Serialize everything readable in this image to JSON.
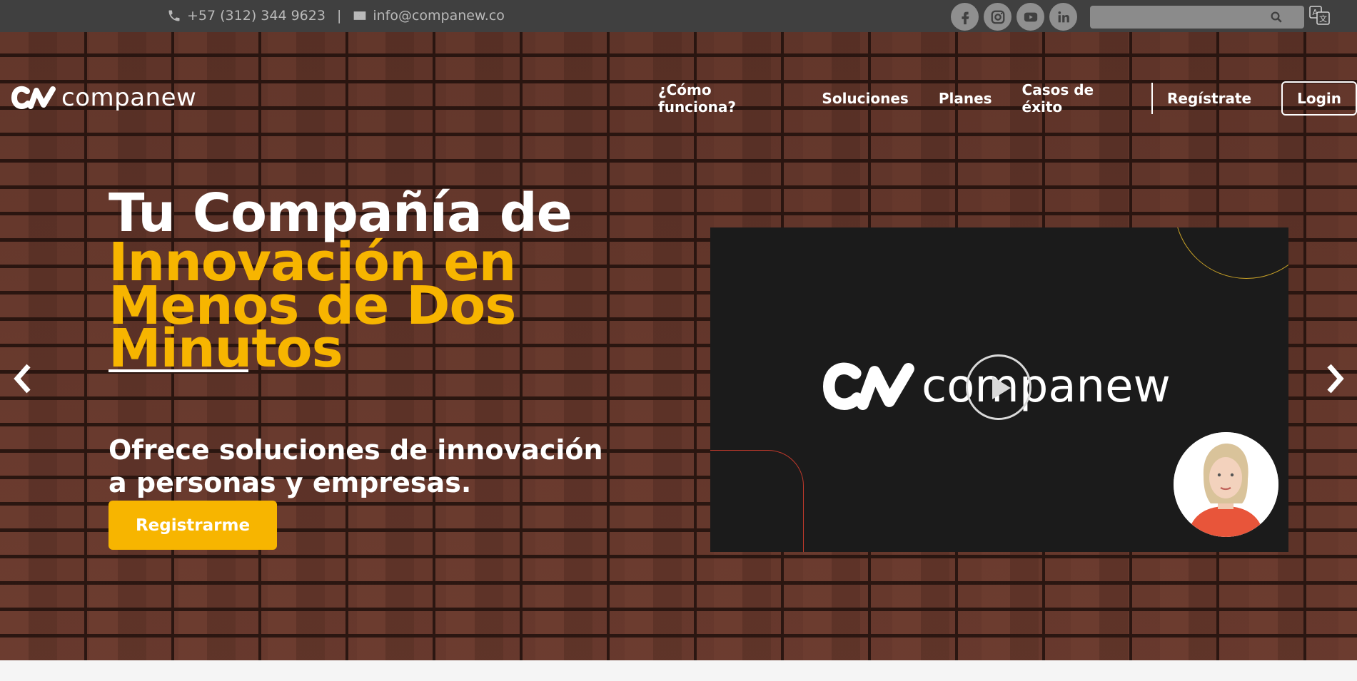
{
  "topbar": {
    "phone": "+57 (312) 344 9623",
    "separator": "|",
    "email": "info@companew.co",
    "socials": [
      {
        "name": "facebook-icon"
      },
      {
        "name": "instagram-icon"
      },
      {
        "name": "youtube-icon"
      },
      {
        "name": "linkedin-icon"
      }
    ],
    "search_placeholder": ""
  },
  "brand": {
    "name": "companew",
    "logo_mark": "CN"
  },
  "nav": {
    "items": [
      "¿Cómo funciona?",
      "Soluciones",
      "Planes",
      "Casos de éxito"
    ],
    "register": "Regístrate",
    "login": "Login"
  },
  "hero": {
    "title_line1": "Tu Compañía de",
    "title_yellow_1": "Innovación en",
    "title_yellow_2": "Menos de Dos",
    "title_yellow_3": "Minutos",
    "subtitle": "Ofrece soluciones de innovación a personas y empresas.",
    "cta": "Registrarme",
    "slides_total": 2,
    "slide_active": 1
  },
  "video": {
    "brand": "companew"
  },
  "colors": {
    "topbar_bg": "#404040",
    "accent_yellow": "#f7b500",
    "white": "#ffffff",
    "video_bg": "#1b1b1b"
  }
}
